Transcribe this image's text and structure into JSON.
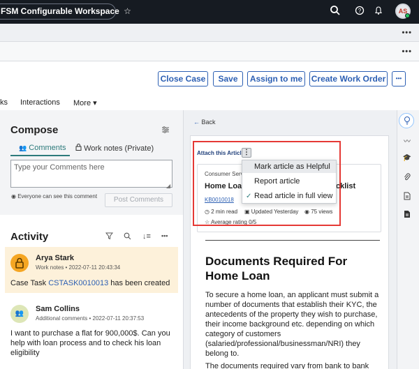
{
  "header": {
    "app_title": "FSM Configurable Workspace",
    "favorite_icon": "star-icon",
    "search_icon": "search-icon",
    "help_icon": "help-icon",
    "notifications_icon": "bell-icon",
    "user_initials": "AS"
  },
  "subheader": {
    "more_label_1": "•••",
    "more_label_2": "•••"
  },
  "actions": {
    "close_case": "Close Case",
    "save": "Save",
    "assign_to_me": "Assign to me",
    "create_work_order": "Create Work Order",
    "more": "•••"
  },
  "tabs": {
    "partial": "ks",
    "interactions": "Interactions",
    "more": "More ▾"
  },
  "compose": {
    "title": "Compose",
    "tab_comments": "Comments",
    "tab_work_notes": "Work notes (Private)",
    "placeholder": "Type your Comments here",
    "visibility_note": "Everyone can see this comment",
    "post_button": "Post Comments"
  },
  "activity": {
    "title": "Activity",
    "items": [
      {
        "name": "Arya Stark",
        "meta": "Work notes • 2022-07-11 20:43:34",
        "text_prefix": "Case Task ",
        "text_link": "CSTASK0010013",
        "text_suffix": " has been created"
      },
      {
        "name": "Sam Collins",
        "meta": "Additional comments • 2022-07-11 20:37:53",
        "text_line1": "I want to purchase a flat for 900,000$. Can you",
        "text_line2": "help with loan process and to check his loan",
        "text_line3": "eligibility"
      }
    ]
  },
  "article_panel": {
    "back": "Back",
    "attach_label": "Attach this Article",
    "kebab": "⋮",
    "category": "Consumer Serv",
    "title_left": "Home Loan",
    "title_right": "cklist",
    "kb_number": "KB0010018",
    "read_time": "2 min read",
    "updated": "Updated Yesterday",
    "views": "75 views",
    "rating": "Average rating 0/5",
    "menu": {
      "mark_helpful": "Mark article as Helpful",
      "report": "Report article",
      "read_full": "Read article in full view"
    },
    "doc_title": "Documents Required For Home Loan",
    "doc_body": "To secure a home loan, an applicant must submit a number of documents that establish their KYC, the antecedents of the property they wish to purchase, their income background etc. depending on which category of customers (salaried/professional/businessman/NRI) they belong to.",
    "doc_tail": "The documents required vary from bank to bank"
  },
  "rail_icons": [
    "lightbulb-icon",
    "activity-icon",
    "graduation-cap-icon",
    "paperclip-icon",
    "document-icon",
    "file-icon"
  ]
}
